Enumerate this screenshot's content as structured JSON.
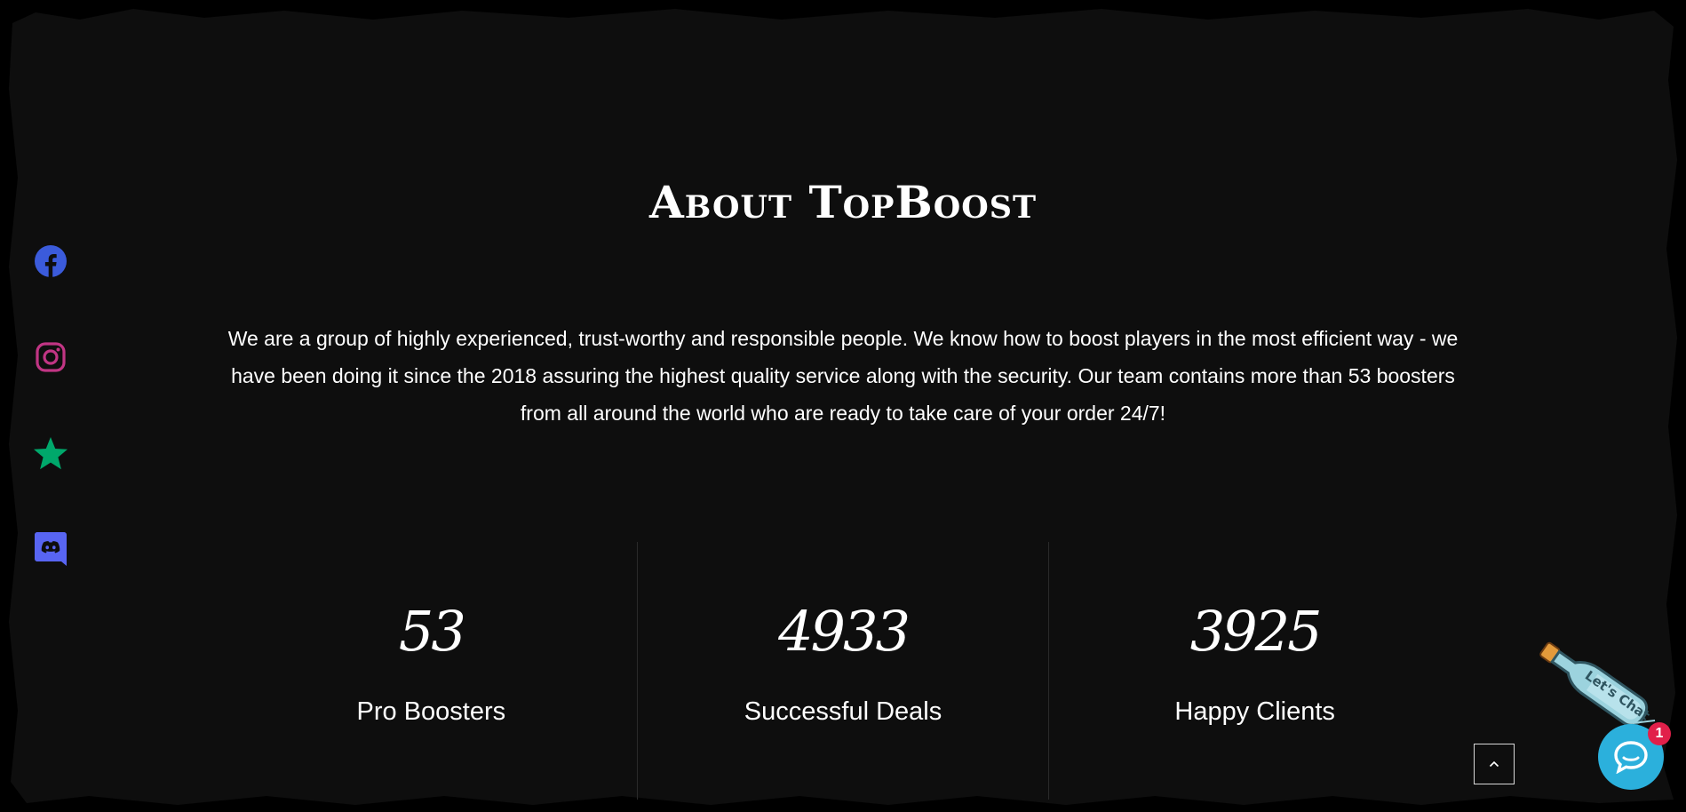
{
  "about": {
    "title": "About TopBoost",
    "description": "We are a group of highly experienced, trust-worthy and responsible people. We know how to boost players in the most efficient way - we have been doing it since the 2018 assuring the highest quality service along with the security. Our team contains more than 53 boosters from all around the world who are ready to take care of your order 24/7!"
  },
  "stats": [
    {
      "value": "53",
      "label": "Pro Boosters"
    },
    {
      "value": "4933",
      "label": "Successful Deals"
    },
    {
      "value": "3925",
      "label": "Happy Clients"
    }
  ],
  "social": [
    {
      "icon": "facebook-icon",
      "color": "#3b5bdb"
    },
    {
      "icon": "instagram-icon",
      "color": "#c13584"
    },
    {
      "icon": "star-icon",
      "color": "#00a86b"
    },
    {
      "icon": "discord-icon",
      "color": "#5865f2"
    }
  ],
  "chat": {
    "bottle_text": "Let's Chat",
    "badge_count": "1",
    "button_color": "#2bb0dc",
    "badge_color": "#e1204a"
  },
  "scroll_top": {
    "icon": "chevron-up-icon"
  },
  "colors": {
    "background": "#0e0e0e",
    "text": "#ffffff"
  }
}
